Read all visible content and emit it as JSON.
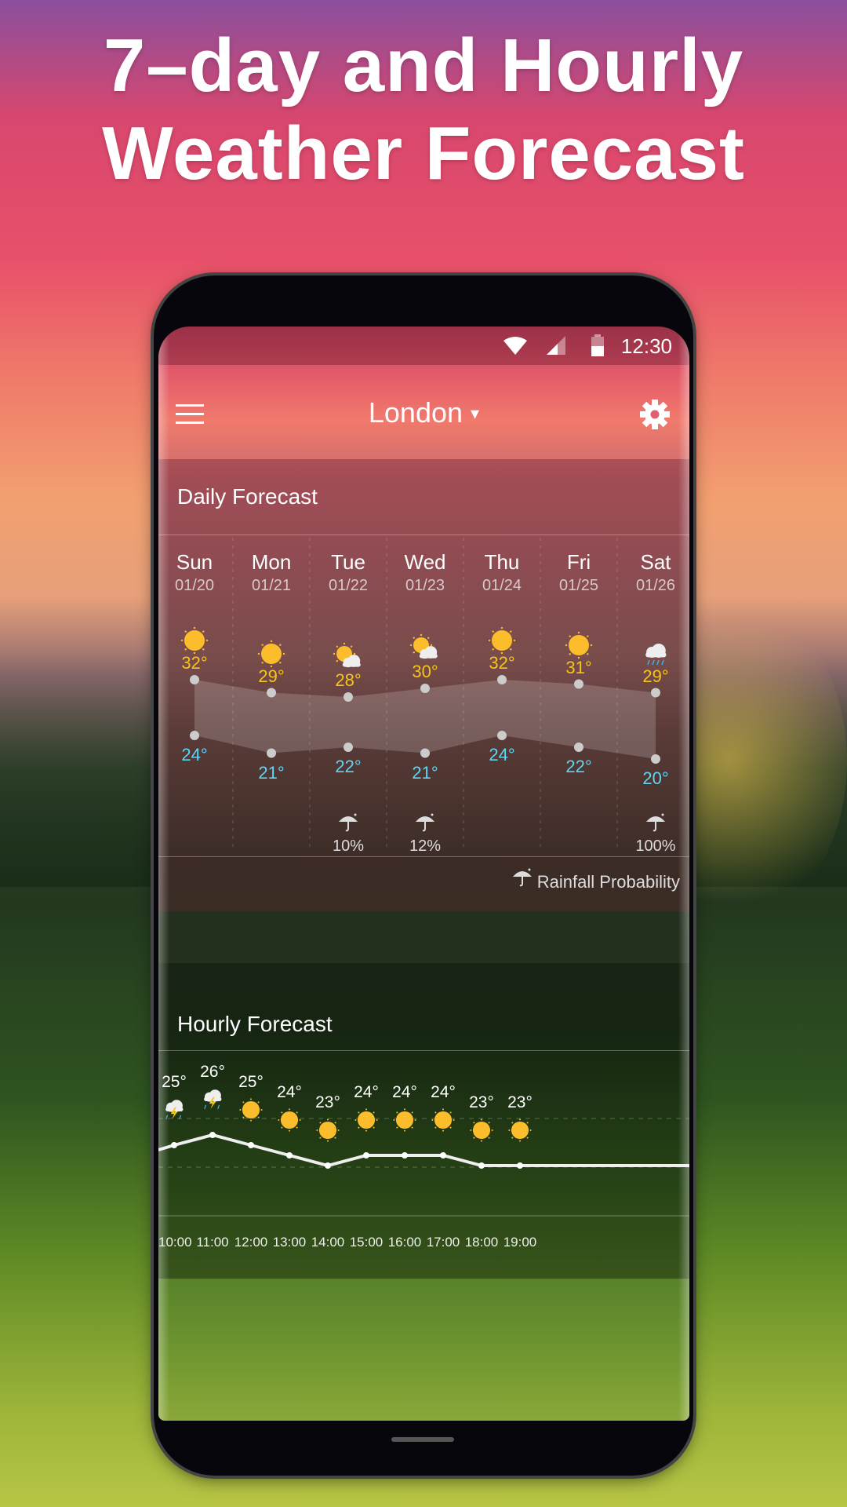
{
  "headline": {
    "line1": "7–day and Hourly",
    "line2": "Weather Forecast"
  },
  "status_bar": {
    "time": "12:30",
    "icons": [
      "wifi-icon",
      "signal-icon",
      "battery-icon"
    ]
  },
  "app_bar": {
    "city": "London",
    "dropdown_icon": "▾",
    "menu_icon": "hamburger-icon",
    "settings_icon": "gear-icon"
  },
  "colors": {
    "high": "#f5c518",
    "low": "#5fd6f5",
    "sun": "#fbbd2c"
  },
  "daily": {
    "title": "Daily Forecast",
    "days": [
      {
        "day": "Sun",
        "date": "01/20",
        "icon": "sunny",
        "high": "32°",
        "low": "24°",
        "rain": ""
      },
      {
        "day": "Mon",
        "date": "01/21",
        "icon": "sunny",
        "high": "29°",
        "low": "21°",
        "rain": ""
      },
      {
        "day": "Tue",
        "date": "01/22",
        "icon": "partly-cloudy",
        "high": "28°",
        "low": "22°",
        "rain": "10%"
      },
      {
        "day": "Wed",
        "date": "01/23",
        "icon": "partly-cloudy",
        "high": "30°",
        "low": "21°",
        "rain": "12%"
      },
      {
        "day": "Thu",
        "date": "01/24",
        "icon": "sunny",
        "high": "32°",
        "low": "24°",
        "rain": ""
      },
      {
        "day": "Fri",
        "date": "01/25",
        "icon": "sunny",
        "high": "31°",
        "low": "22°",
        "rain": ""
      },
      {
        "day": "Sat",
        "date": "01/26",
        "icon": "rain",
        "high": "29°",
        "low": "20°",
        "rain": "100%"
      }
    ],
    "highs": [
      32,
      29,
      28,
      30,
      32,
      31,
      29
    ],
    "lows": [
      24,
      21,
      22,
      21,
      24,
      22,
      20
    ],
    "legend": "Rainfall Probability"
  },
  "hourly": {
    "title": "Hourly Forecast",
    "hours": [
      {
        "time": "10:00",
        "temp": "25°",
        "icon": "thunderstorm"
      },
      {
        "time": "11:00",
        "temp": "26°",
        "icon": "thunderstorm"
      },
      {
        "time": "12:00",
        "temp": "25°",
        "icon": "sunny"
      },
      {
        "time": "13:00",
        "temp": "24°",
        "icon": "sunny"
      },
      {
        "time": "14:00",
        "temp": "23°",
        "icon": "sunny"
      },
      {
        "time": "15:00",
        "temp": "24°",
        "icon": "sunny"
      },
      {
        "time": "16:00",
        "temp": "24°",
        "icon": "sunny"
      },
      {
        "time": "17:00",
        "temp": "24°",
        "icon": "sunny"
      },
      {
        "time": "18:00",
        "temp": "23°",
        "icon": "sunny"
      },
      {
        "time": "19:00",
        "temp": "23°",
        "icon": "sunny"
      }
    ],
    "temps": [
      25,
      26,
      25,
      24,
      23,
      24,
      24,
      24,
      23,
      23
    ]
  }
}
